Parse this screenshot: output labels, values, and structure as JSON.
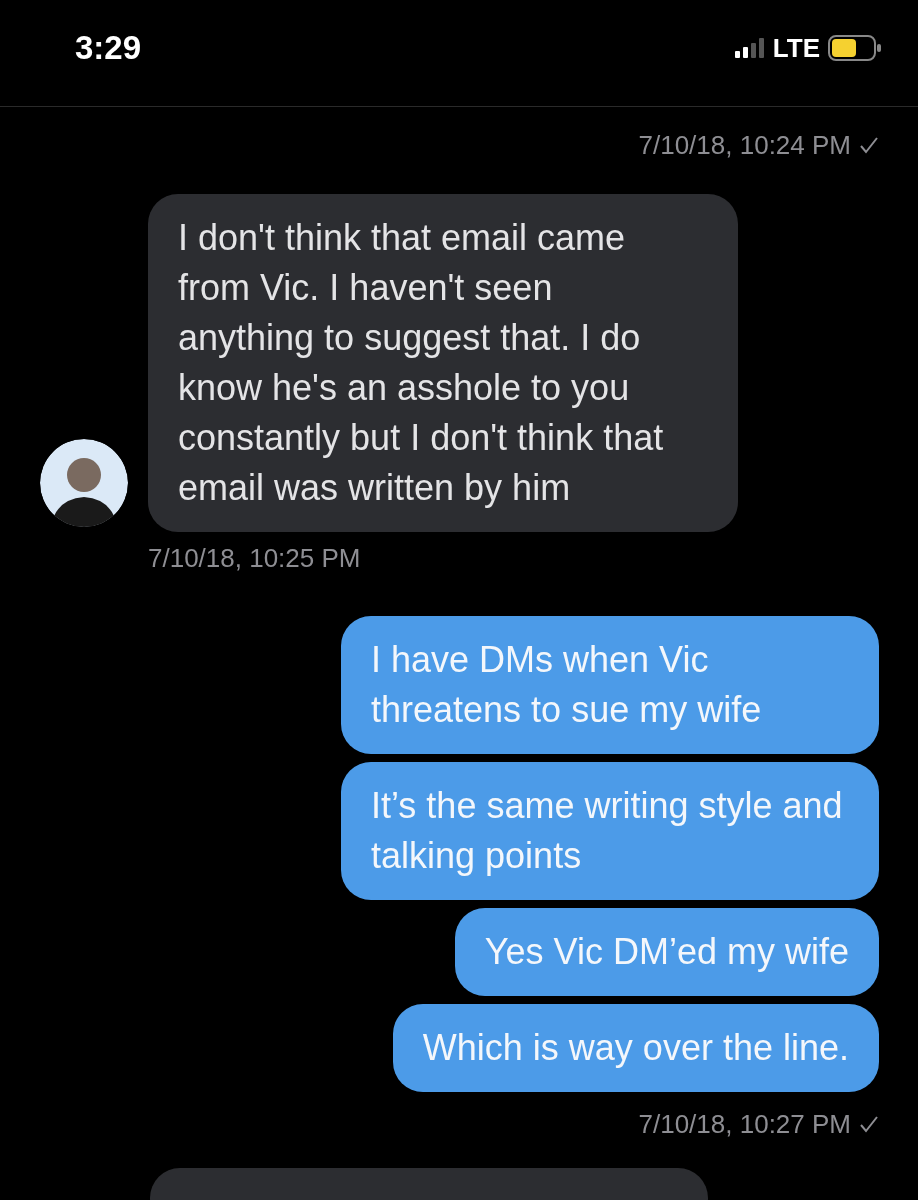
{
  "status_bar": {
    "time": "3:29",
    "network": "LTE"
  },
  "messages": [
    {
      "kind": "timestamp",
      "sent": true,
      "text": "7/10/18, 10:24 PM",
      "delivered": true
    },
    {
      "kind": "bubble",
      "sent": false,
      "text": "I don't think that email came from Vic. I haven't seen anything to suggest that. I do know he's an asshole to you constantly but I don't think that email was written by him"
    },
    {
      "kind": "timestamp",
      "sent": false,
      "text": "7/10/18, 10:25 PM",
      "delivered": false
    },
    {
      "kind": "bubble",
      "sent": true,
      "text": "I have DMs when Vic threatens to sue my wife"
    },
    {
      "kind": "bubble",
      "sent": true,
      "text": "It’s the same writing style and talking points"
    },
    {
      "kind": "bubble",
      "sent": true,
      "text": "Yes Vic DM’ed my wife"
    },
    {
      "kind": "bubble",
      "sent": true,
      "text": "Which is way over the line."
    },
    {
      "kind": "timestamp",
      "sent": true,
      "text": "7/10/18, 10:27 PM",
      "delivered": true
    },
    {
      "kind": "partial"
    }
  ]
}
